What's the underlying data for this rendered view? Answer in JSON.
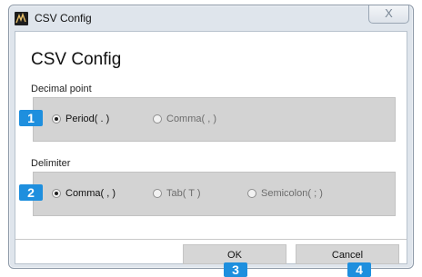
{
  "window": {
    "title": "CSV Config",
    "close_label": "X"
  },
  "dialog": {
    "heading": "CSV Config",
    "decimal_point": {
      "label": "Decimal point",
      "options": [
        {
          "label": "Period( . )",
          "selected": true
        },
        {
          "label": "Comma( , )",
          "selected": false
        }
      ]
    },
    "delimiter": {
      "label": "Delimiter",
      "options": [
        {
          "label": "Comma( , )",
          "selected": true
        },
        {
          "label": "Tab( T )",
          "selected": false
        },
        {
          "label": "Semicolon( ; )",
          "selected": false
        }
      ]
    },
    "buttons": {
      "ok": "OK",
      "cancel": "Cancel"
    }
  },
  "callouts": [
    "1",
    "2",
    "3",
    "4"
  ],
  "colors": {
    "callout": "#1e8fde",
    "group_bg": "#d3d3d3",
    "frame": "#dfe5ec"
  }
}
